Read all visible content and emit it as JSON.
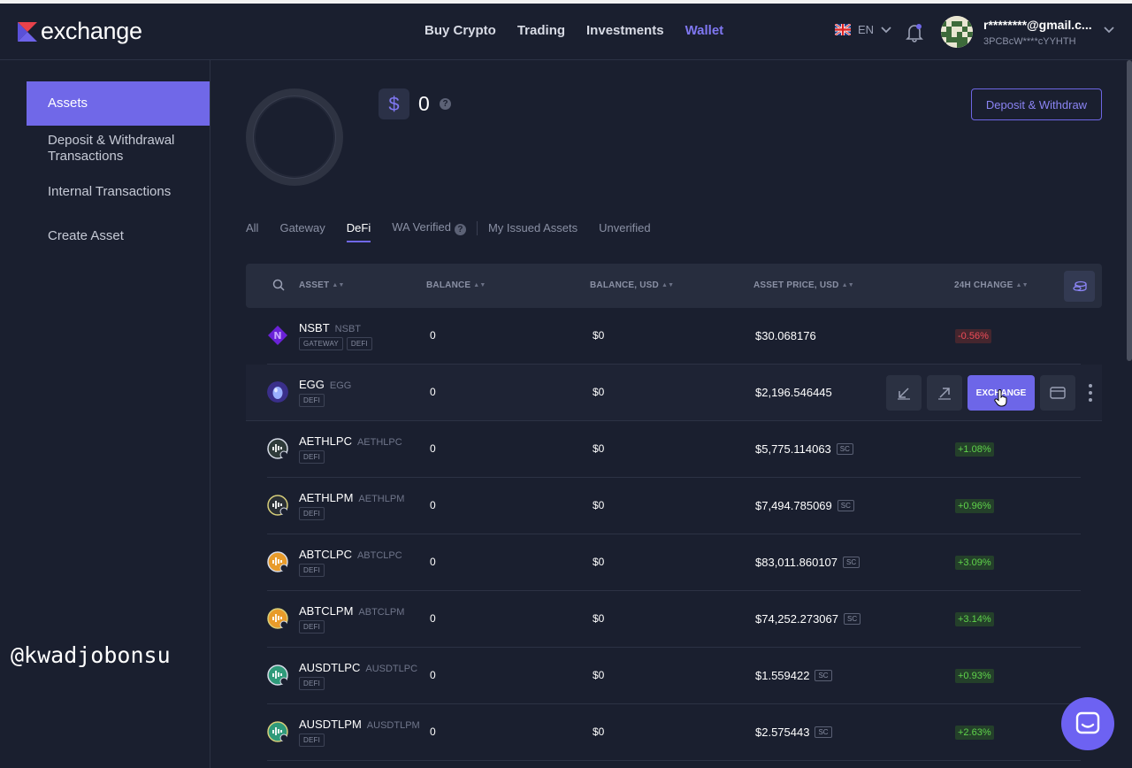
{
  "header": {
    "logo_text": "exchange",
    "nav": [
      "Buy Crypto",
      "Trading",
      "Investments",
      "Wallet"
    ],
    "active_nav": "Wallet",
    "language": "EN",
    "user_email": "r********@gmail.c...",
    "user_address": "3PCBcW****cYYHTH"
  },
  "sidebar": {
    "items": [
      "Assets",
      "Deposit & Withdrawal Transactions",
      "Internal Transactions",
      "Create Asset"
    ],
    "active": "Assets"
  },
  "watermark": "@kwadjobonsu",
  "summary": {
    "currency_symbol": "$",
    "total": "0",
    "help": "?",
    "deposit_withdraw_label": "Deposit & Withdraw"
  },
  "tabs": {
    "items": [
      "All",
      "Gateway",
      "DeFi",
      "WA Verified",
      "My Issued Assets",
      "Unverified"
    ],
    "active": "DeFi",
    "help": "?"
  },
  "table": {
    "headers": [
      "ASSET",
      "BALANCE",
      "BALANCE, USD",
      "ASSET PRICE, USD",
      "24H CHANGE"
    ],
    "exchange_label": "EXCHANGE",
    "sc_label": "SC",
    "rows": [
      {
        "name": "NSBT",
        "symbol": "NSBT",
        "tags": [
          "GATEWAY",
          "DEFI"
        ],
        "balance": "0",
        "balance_usd": "$0",
        "price": "$30.068176",
        "sc": false,
        "change": "-0.56%",
        "dir": "down"
      },
      {
        "name": "EGG",
        "symbol": "EGG",
        "tags": [
          "DEFI"
        ],
        "balance": "0",
        "balance_usd": "$0",
        "price": "$2,196.546445",
        "sc": false,
        "change": "",
        "dir": ""
      },
      {
        "name": "AETHLPC",
        "symbol": "AETHLPC",
        "tags": [
          "DEFI"
        ],
        "balance": "0",
        "balance_usd": "$0",
        "price": "$5,775.114063",
        "sc": true,
        "change": "+1.08%",
        "dir": "up"
      },
      {
        "name": "AETHLPM",
        "symbol": "AETHLPM",
        "tags": [
          "DEFI"
        ],
        "balance": "0",
        "balance_usd": "$0",
        "price": "$7,494.785069",
        "sc": true,
        "change": "+0.96%",
        "dir": "up"
      },
      {
        "name": "ABTCLPC",
        "symbol": "ABTCLPC",
        "tags": [
          "DEFI"
        ],
        "balance": "0",
        "balance_usd": "$0",
        "price": "$83,011.860107",
        "sc": true,
        "change": "+3.09%",
        "dir": "up"
      },
      {
        "name": "ABTCLPM",
        "symbol": "ABTCLPM",
        "tags": [
          "DEFI"
        ],
        "balance": "0",
        "balance_usd": "$0",
        "price": "$74,252.273067",
        "sc": true,
        "change": "+3.14%",
        "dir": "up"
      },
      {
        "name": "AUSDTLPC",
        "symbol": "AUSDTLPC",
        "tags": [
          "DEFI"
        ],
        "balance": "0",
        "balance_usd": "$0",
        "price": "$1.559422",
        "sc": true,
        "change": "+0.93%",
        "dir": "up"
      },
      {
        "name": "AUSDTLPM",
        "symbol": "AUSDTLPM",
        "tags": [
          "DEFI"
        ],
        "balance": "0",
        "balance_usd": "$0",
        "price": "$2.575443",
        "sc": true,
        "change": "+2.63%",
        "dir": "up"
      }
    ]
  },
  "colors": {
    "accent": "#7068e8",
    "background": "#1a1f2f",
    "positive": "#5fd34b",
    "negative": "#ef4c58"
  }
}
